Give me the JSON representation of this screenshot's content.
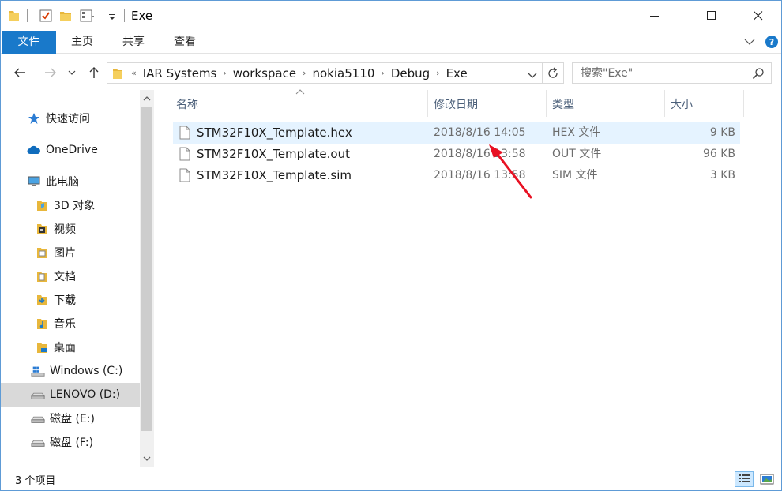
{
  "window": {
    "title": "Exe"
  },
  "ribbon": {
    "tabs": [
      {
        "label": "文件"
      },
      {
        "label": "主页"
      },
      {
        "label": "共享"
      },
      {
        "label": "查看"
      }
    ]
  },
  "address": {
    "overflow": "«",
    "crumbs": [
      "IAR Systems",
      "workspace",
      "nokia5110",
      "Debug",
      "Exe"
    ]
  },
  "search": {
    "placeholder": "搜索\"Exe\""
  },
  "nav": {
    "items": [
      {
        "label": "快速访问",
        "icon": "star-icon"
      },
      {
        "label": "OneDrive",
        "icon": "cloud-icon"
      },
      {
        "label": "此电脑",
        "icon": "computer-icon"
      },
      {
        "label": "3D 对象",
        "icon": "folder-3d-icon"
      },
      {
        "label": "视频",
        "icon": "folder-video-icon"
      },
      {
        "label": "图片",
        "icon": "folder-pictures-icon"
      },
      {
        "label": "文档",
        "icon": "folder-documents-icon"
      },
      {
        "label": "下载",
        "icon": "folder-downloads-icon"
      },
      {
        "label": "音乐",
        "icon": "folder-music-icon"
      },
      {
        "label": "桌面",
        "icon": "folder-desktop-icon"
      },
      {
        "label": "Windows (C:)",
        "icon": "windows-drive-icon"
      },
      {
        "label": "LENOVO (D:)",
        "icon": "drive-icon"
      },
      {
        "label": "磁盘 (E:)",
        "icon": "drive-icon"
      },
      {
        "label": "磁盘 (F:)",
        "icon": "drive-icon"
      }
    ]
  },
  "columns": {
    "name": "名称",
    "date": "修改日期",
    "type": "类型",
    "size": "大小"
  },
  "files": [
    {
      "name": "STM32F10X_Template.hex",
      "date": "2018/8/16 14:05",
      "type": "HEX 文件",
      "size": "9 KB"
    },
    {
      "name": "STM32F10X_Template.out",
      "date": "2018/8/16 13:58",
      "type": "OUT 文件",
      "size": "96 KB"
    },
    {
      "name": "STM32F10X_Template.sim",
      "date": "2018/8/16 13:58",
      "type": "SIM 文件",
      "size": "3 KB"
    }
  ],
  "status": {
    "count": "3 个项目"
  },
  "colors": {
    "accent": "#1979ca",
    "annotation": "#e81123"
  }
}
